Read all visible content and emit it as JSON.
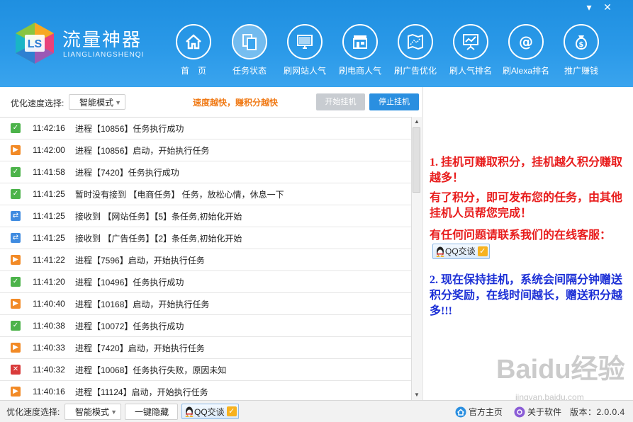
{
  "app": {
    "title": "流量神器",
    "subtitle": "LIANGLIANGSHENQI"
  },
  "window_controls": {
    "minimize": "▾",
    "close": "✕"
  },
  "nav": [
    {
      "label": "首　页",
      "icon": "home-icon"
    },
    {
      "label": "任务状态",
      "icon": "documents-icon"
    },
    {
      "label": "刷网站人气",
      "icon": "monitor-icon"
    },
    {
      "label": "刷电商人气",
      "icon": "store-icon"
    },
    {
      "label": "刷广告优化",
      "icon": "map-chart-icon"
    },
    {
      "label": "刷人气排名",
      "icon": "presentation-chart-icon"
    },
    {
      "label": "刷Alexa排名",
      "icon": "at-sign-icon"
    },
    {
      "label": "推广赚钱",
      "icon": "money-bag-icon"
    }
  ],
  "toolbar": {
    "speed_label": "优化速度选择:",
    "speed_value": "智能模式",
    "slogan": "速度越快，赚积分越快",
    "start_button": "开始挂机",
    "stop_button": "停止挂机"
  },
  "logs": [
    {
      "status": "success",
      "time": "11:42:16",
      "msg": "进程【10856】任务执行成功"
    },
    {
      "status": "start",
      "time": "11:42:00",
      "msg": "进程【10856】启动，开始执行任务"
    },
    {
      "status": "success",
      "time": "11:41:58",
      "msg": "进程【7420】任务执行成功"
    },
    {
      "status": "success",
      "time": "11:41:25",
      "msg": "暂时没有接到 【电商任务】 任务，放松心情，休息一下"
    },
    {
      "status": "receive",
      "time": "11:41:25",
      "msg": "接收到 【网站任务】【5】条任务,初始化开始"
    },
    {
      "status": "receive",
      "time": "11:41:25",
      "msg": "接收到 【广告任务】【2】条任务,初始化开始"
    },
    {
      "status": "start",
      "time": "11:41:22",
      "msg": "进程【7596】启动，开始执行任务"
    },
    {
      "status": "success",
      "time": "11:41:20",
      "msg": "进程【10496】任务执行成功"
    },
    {
      "status": "start",
      "time": "11:40:40",
      "msg": "进程【10168】启动，开始执行任务"
    },
    {
      "status": "success",
      "time": "11:40:38",
      "msg": "进程【10072】任务执行成功"
    },
    {
      "status": "start",
      "time": "11:40:33",
      "msg": "进程【7420】启动，开始执行任务"
    },
    {
      "status": "fail",
      "time": "11:40:32",
      "msg": "进程【10068】任务执行失败，原因未知"
    },
    {
      "status": "start",
      "time": "11:40:16",
      "msg": "进程【11124】启动，开始执行任务"
    }
  ],
  "notices": {
    "p1": "1. 挂机可赚取积分，挂机越久积分赚取越多！",
    "p2": "有了积分，即可发布您的任务，由其他挂机人员帮您完成！",
    "p3": "有任何问题请联系我们的在线客服：",
    "p4": "2. 现在保持挂机，系统会间隔分钟赠送积分奖励，在线时间越长，赠送积分越多!!!"
  },
  "qq_button": "QQ交谈",
  "footer": {
    "speed_label": "优化速度选择:",
    "speed_value": "智能模式",
    "hide_button": "一键隐藏",
    "qq_button": "QQ交谈",
    "homepage": "官方主页",
    "about": "关于软件",
    "version": "版本：2.0.0.4"
  },
  "watermark": {
    "text": "Baidu经验",
    "url": "jingyan.baidu.com"
  },
  "colors": {
    "header_blue": "#2a99e8",
    "success": "#4cb34a",
    "start": "#f28a26",
    "receive": "#3f8be0",
    "fail": "#d93b3b",
    "notice_red": "#e81c1c",
    "notice_blue": "#1b2fd6",
    "slogan": "#f07a16"
  }
}
